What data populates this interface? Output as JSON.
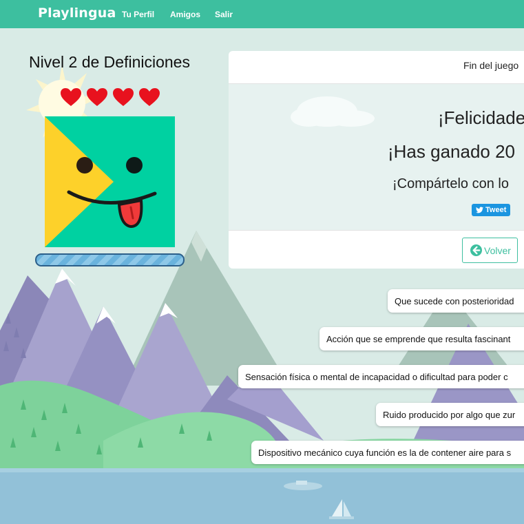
{
  "navbar": {
    "brand": "Playlingua",
    "links": [
      "Tu Perfil",
      "Amigos",
      "Salir"
    ]
  },
  "game": {
    "level_title": "Nivel 2 de Definiciones",
    "lives": 4,
    "progress": 1.0
  },
  "result_panel": {
    "title": "Fin del juego",
    "congrats": "¡Felicidade",
    "won": "¡Has ganado 20",
    "share": "¡Compártelo con lo",
    "tweet_label": "Tweet",
    "back_label": "Volver"
  },
  "definitions": [
    "Que sucede con posterioridad",
    "Acción que se emprende que resulta fascinant",
    "Sensación física o mental de incapacidad o dificultad para poder c",
    "Ruido producido por algo que zur",
    "Dispositivo mecánico cuya función es la de contener aire para s"
  ],
  "colors": {
    "accent": "#3dbf9f",
    "sky": "#d9ebe6",
    "heart": "#e8121e",
    "mascot_green": "#00d1a1",
    "mascot_yellow": "#fdd12a",
    "tweet": "#1b95e0"
  },
  "icons": {
    "heart": "heart-icon",
    "tweet": "twitter-bird-icon",
    "back": "arrow-circle-left-icon"
  }
}
